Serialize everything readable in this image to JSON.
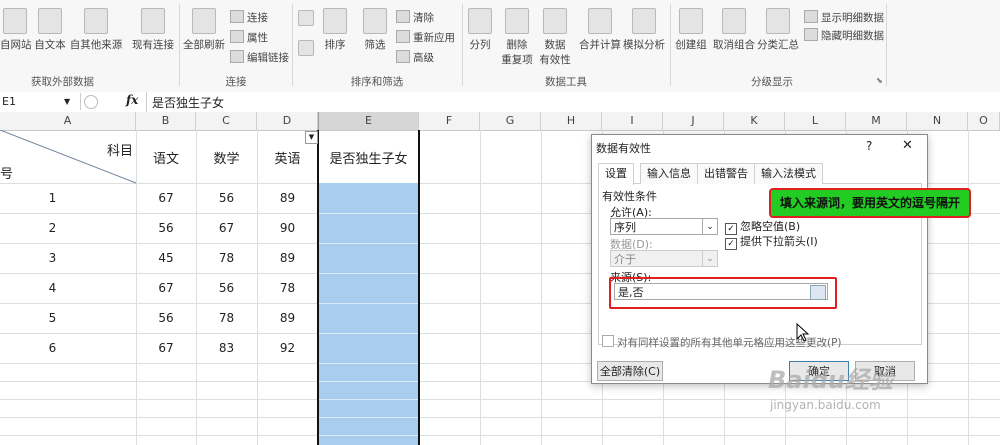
{
  "ribbon": {
    "get_data_group": {
      "label": "获取外部数据",
      "buttons": [
        "自网站",
        "自文本",
        "自其他来源",
        "现有连接"
      ]
    },
    "connections_group": {
      "label": "连接",
      "refresh_all": "全部刷新",
      "items": [
        "连接",
        "属性",
        "编辑链接"
      ]
    },
    "sort_group": {
      "label": "排序和筛选",
      "sort": "排序",
      "filter": "筛选",
      "items": [
        "清除",
        "重新应用",
        "高级"
      ]
    },
    "tools_group": {
      "label": "数据工具",
      "buttons": [
        "分列",
        "删除",
        "数据",
        "合并计算",
        "模拟分析"
      ],
      "sub": [
        "重复项",
        "有效性"
      ]
    },
    "outline_group": {
      "label": "分级显示",
      "buttons": [
        "创建组",
        "取消组合",
        "分类汇总"
      ],
      "items": [
        "显示明细数据",
        "隐藏明细数据"
      ]
    }
  },
  "formula_bar": {
    "name_box": "E1",
    "fx": "fx",
    "formula": "是否独生子女"
  },
  "grid": {
    "columns": [
      "A",
      "B",
      "C",
      "D",
      "E",
      "F",
      "G",
      "H",
      "I",
      "J",
      "K",
      "L",
      "M",
      "N",
      "O"
    ],
    "header": {
      "subject": "科目",
      "number": "号",
      "cols": [
        "语文",
        "数学",
        "英语",
        "是否独生子女"
      ]
    },
    "rows": [
      {
        "id": "1",
        "vals": [
          "67",
          "56",
          "89"
        ]
      },
      {
        "id": "2",
        "vals": [
          "56",
          "67",
          "90"
        ]
      },
      {
        "id": "3",
        "vals": [
          "45",
          "78",
          "89"
        ]
      },
      {
        "id": "4",
        "vals": [
          "67",
          "56",
          "78"
        ]
      },
      {
        "id": "5",
        "vals": [
          "56",
          "78",
          "89"
        ]
      },
      {
        "id": "6",
        "vals": [
          "67",
          "83",
          "92"
        ]
      }
    ]
  },
  "dialog": {
    "title": "数据有效性",
    "help": "?",
    "close": "✕",
    "tabs": [
      "设置",
      "输入信息",
      "出错警告",
      "输入法模式"
    ],
    "criteria_label": "有效性条件",
    "allow_label": "允许(A):",
    "allow_value": "序列",
    "data_label": "数据(D):",
    "data_value": "介于",
    "ignore_blank": "忽略空值(B)",
    "dropdown": "提供下拉箭头(I)",
    "source_label": "来源(S):",
    "source_value": "是,否",
    "apply_all": "对有同样设置的所有其他单元格应用这些更改(P)",
    "clear_all": "全部清除(C)",
    "ok": "确定",
    "cancel": "取消"
  },
  "callout": {
    "text": "填入来源词，要用英文的逗号隔开"
  },
  "watermark": {
    "text": "Baidu经验",
    "url": "jingyan.baidu.com"
  },
  "colors": {
    "selection": "#a8cdee",
    "callout_bg": "#22cc22",
    "highlight_border": "#e02020"
  }
}
